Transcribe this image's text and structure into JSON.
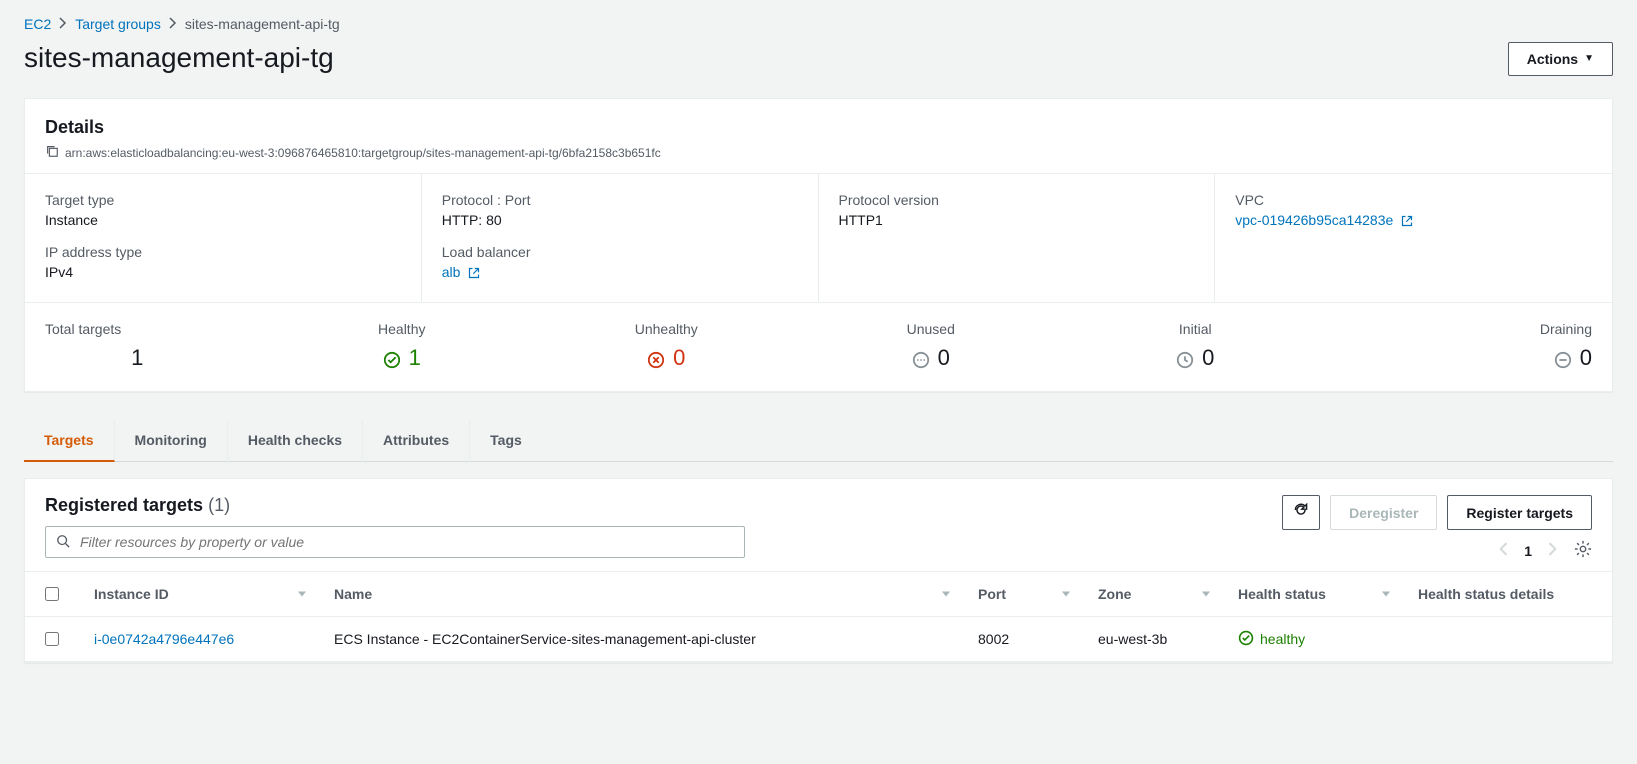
{
  "breadcrumb": {
    "root": "EC2",
    "parent": "Target groups",
    "current": "sites-management-api-tg"
  },
  "title": "sites-management-api-tg",
  "actions_label": "Actions",
  "details": {
    "heading": "Details",
    "arn": "arn:aws:elasticloadbalancing:eu-west-3:096876465810:targetgroup/sites-management-api-tg/6bfa2158c3b651fc",
    "target_type": {
      "label": "Target type",
      "value": "Instance"
    },
    "ip_addr_type": {
      "label": "IP address type",
      "value": "IPv4"
    },
    "protocol_port": {
      "label": "Protocol : Port",
      "value": "HTTP: 80"
    },
    "load_balancer": {
      "label": "Load balancer",
      "link_text": "alb"
    },
    "protocol_version": {
      "label": "Protocol version",
      "value": "HTTP1"
    },
    "vpc": {
      "label": "VPC",
      "link_text": "vpc-019426b95ca14283e"
    }
  },
  "status": {
    "total": {
      "label": "Total targets",
      "value": "1"
    },
    "healthy": {
      "label": "Healthy",
      "value": "1"
    },
    "unhealthy": {
      "label": "Unhealthy",
      "value": "0"
    },
    "unused": {
      "label": "Unused",
      "value": "0"
    },
    "initial": {
      "label": "Initial",
      "value": "0"
    },
    "draining": {
      "label": "Draining",
      "value": "0"
    }
  },
  "tabs": {
    "targets": "Targets",
    "monitoring": "Monitoring",
    "health_checks": "Health checks",
    "attributes": "Attributes",
    "tags": "Tags"
  },
  "targets": {
    "heading": "Registered targets",
    "count_display": "(1)",
    "filter_placeholder": "Filter resources by property or value",
    "buttons": {
      "refresh": "Refresh",
      "deregister": "Deregister",
      "register": "Register targets"
    },
    "pager": {
      "page": "1"
    },
    "columns": {
      "instance_id": "Instance ID",
      "name": "Name",
      "port": "Port",
      "zone": "Zone",
      "health_status": "Health status",
      "health_details": "Health status details"
    },
    "rows": [
      {
        "instance_id": "i-0e0742a4796e447e6",
        "name": "ECS Instance - EC2ContainerService-sites-management-api-cluster",
        "port": "8002",
        "zone": "eu-west-3b",
        "health_status": "healthy",
        "health_details": ""
      }
    ]
  }
}
